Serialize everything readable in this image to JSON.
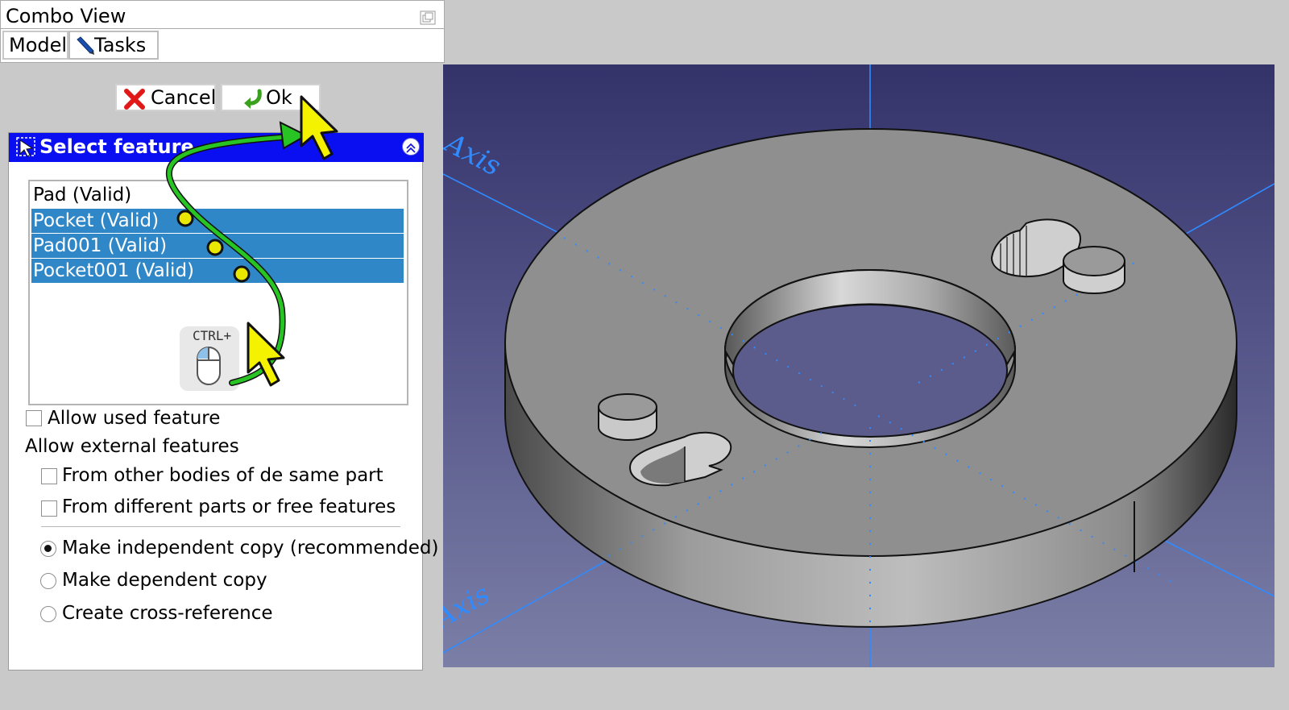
{
  "window": {
    "title": "Combo View"
  },
  "tabs": [
    {
      "label": "Model"
    },
    {
      "label": "Tasks",
      "icon": "pencil-icon"
    }
  ],
  "buttons": {
    "cancel_label": "Cancel",
    "ok_label": "Ok"
  },
  "panel": {
    "header_title": "Select feature",
    "header_color": "#0a0ff2",
    "items": [
      {
        "label": "Pad (Valid)",
        "selected": false
      },
      {
        "label": "Pocket (Valid)",
        "selected": true
      },
      {
        "label": "Pad001 (Valid)",
        "selected": true
      },
      {
        "label": "Pocket001 (Valid)",
        "selected": true
      }
    ],
    "selection_color": "#3087c8",
    "ctrl_hint": "CTRL+",
    "allow_used_feature": "Allow used feature",
    "allow_external_heading": "Allow external features",
    "external_options": [
      "From other bodies of de same part",
      "From different parts or free features"
    ],
    "copy_options": [
      {
        "label": "Make independent copy (recommended)",
        "checked": true
      },
      {
        "label": "Make dependent copy",
        "checked": false
      },
      {
        "label": "Create cross-reference",
        "checked": false
      }
    ]
  },
  "viewport": {
    "axis_label_top": "Axis",
    "axis_label_bottom": "Axis",
    "axis_color": "#2f8bff"
  }
}
